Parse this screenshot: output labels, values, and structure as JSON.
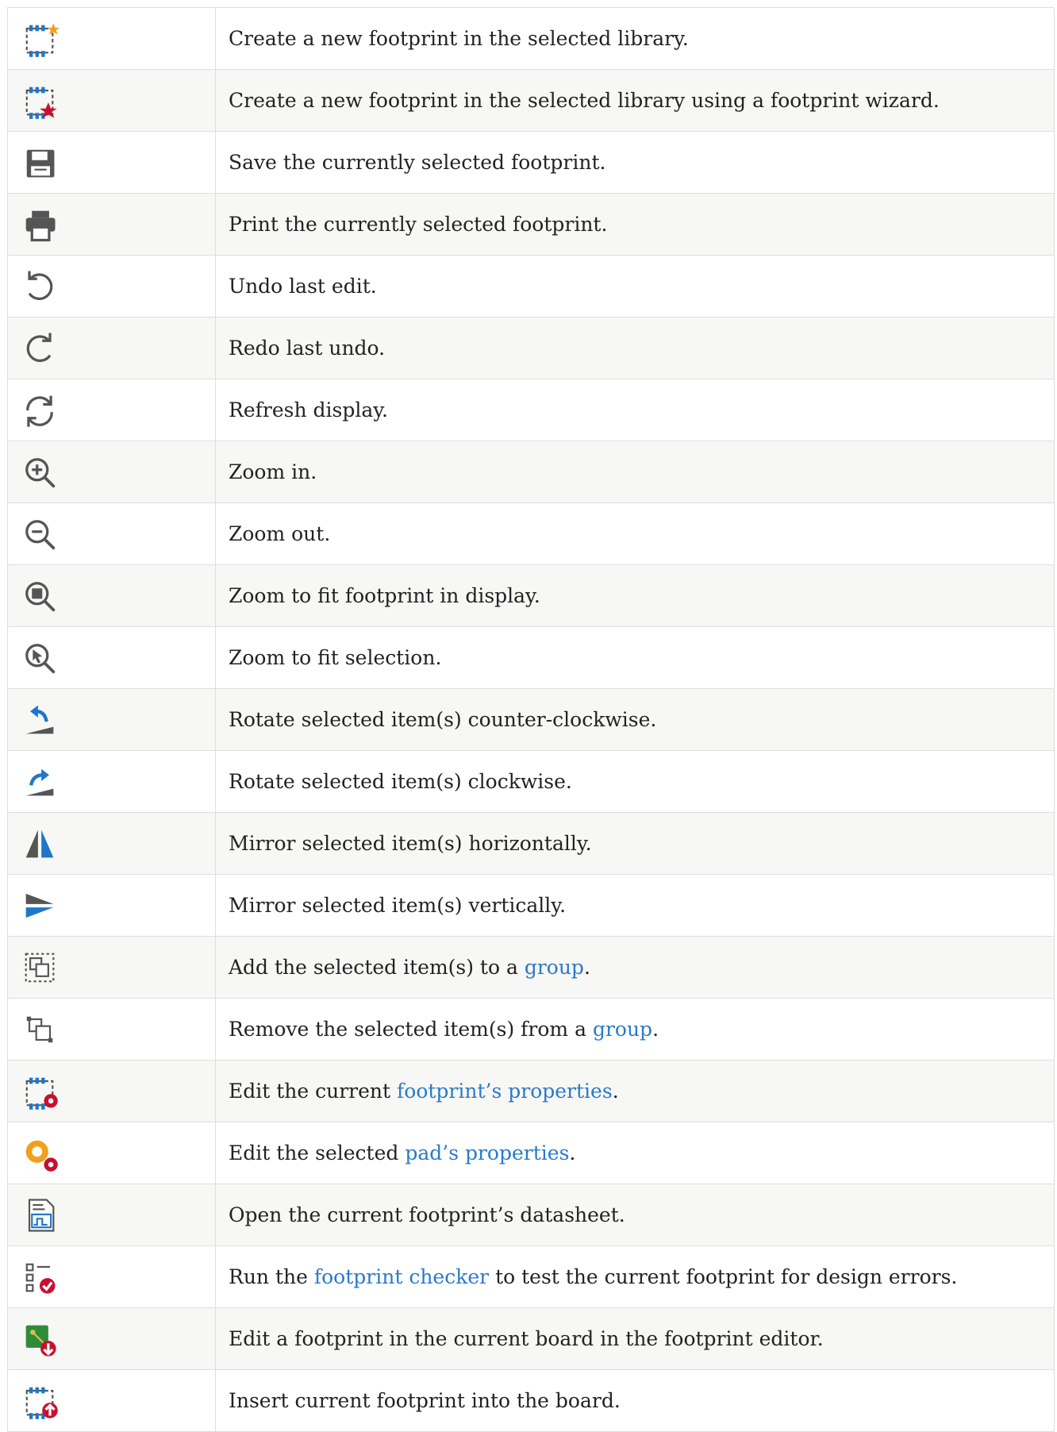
{
  "colors": {
    "link": "#2a7ac8",
    "text": "#222222",
    "border": "#dedede",
    "stripe": "#f7f7f5",
    "icon_gray": "#555555",
    "icon_blue": "#1f77c9",
    "icon_red": "#c8102e"
  },
  "rows": [
    {
      "icon": "new-footprint-icon",
      "segments": [
        {
          "text": "Create a new footprint in the selected library."
        }
      ]
    },
    {
      "icon": "footprint-wizard-icon",
      "segments": [
        {
          "text": "Create a new footprint in the selected library using a footprint wizard."
        }
      ]
    },
    {
      "icon": "save-icon",
      "segments": [
        {
          "text": "Save the currently selected footprint."
        }
      ]
    },
    {
      "icon": "print-icon",
      "segments": [
        {
          "text": "Print the currently selected footprint."
        }
      ]
    },
    {
      "icon": "undo-icon",
      "segments": [
        {
          "text": "Undo last edit."
        }
      ]
    },
    {
      "icon": "redo-icon",
      "segments": [
        {
          "text": "Redo last undo."
        }
      ]
    },
    {
      "icon": "refresh-icon",
      "segments": [
        {
          "text": "Refresh display."
        }
      ]
    },
    {
      "icon": "zoom-in-icon",
      "segments": [
        {
          "text": "Zoom in."
        }
      ]
    },
    {
      "icon": "zoom-out-icon",
      "segments": [
        {
          "text": "Zoom out."
        }
      ]
    },
    {
      "icon": "zoom-fit-icon",
      "segments": [
        {
          "text": "Zoom to fit footprint in display."
        }
      ]
    },
    {
      "icon": "zoom-selection-icon",
      "segments": [
        {
          "text": "Zoom to fit selection."
        }
      ]
    },
    {
      "icon": "rotate-ccw-icon",
      "segments": [
        {
          "text": "Rotate selected item(s) counter-clockwise."
        }
      ]
    },
    {
      "icon": "rotate-cw-icon",
      "segments": [
        {
          "text": "Rotate selected item(s) clockwise."
        }
      ]
    },
    {
      "icon": "mirror-horizontal-icon",
      "segments": [
        {
          "text": "Mirror selected item(s) horizontally."
        }
      ]
    },
    {
      "icon": "mirror-vertical-icon",
      "segments": [
        {
          "text": "Mirror selected item(s) vertically."
        }
      ]
    },
    {
      "icon": "group-icon",
      "segments": [
        {
          "text": "Add the selected item(s) to a "
        },
        {
          "text": "group",
          "link": true
        },
        {
          "text": "."
        }
      ]
    },
    {
      "icon": "ungroup-icon",
      "segments": [
        {
          "text": "Remove the selected item(s) from a "
        },
        {
          "text": "group",
          "link": true
        },
        {
          "text": "."
        }
      ]
    },
    {
      "icon": "footprint-properties-icon",
      "segments": [
        {
          "text": "Edit the current "
        },
        {
          "text": "footprint’s properties",
          "link": true
        },
        {
          "text": "."
        }
      ]
    },
    {
      "icon": "pad-properties-icon",
      "segments": [
        {
          "text": "Edit the selected "
        },
        {
          "text": "pad’s properties",
          "link": true
        },
        {
          "text": "."
        }
      ]
    },
    {
      "icon": "datasheet-icon",
      "segments": [
        {
          "text": "Open the current footprint’s datasheet."
        }
      ]
    },
    {
      "icon": "footprint-checker-icon",
      "segments": [
        {
          "text": "Run the "
        },
        {
          "text": "footprint checker",
          "link": true
        },
        {
          "text": " to test the current footprint for design errors."
        }
      ]
    },
    {
      "icon": "load-from-board-icon",
      "segments": [
        {
          "text": "Edit a footprint in the current board in the footprint editor."
        }
      ]
    },
    {
      "icon": "insert-into-board-icon",
      "segments": [
        {
          "text": "Insert current footprint into the board."
        }
      ]
    }
  ]
}
